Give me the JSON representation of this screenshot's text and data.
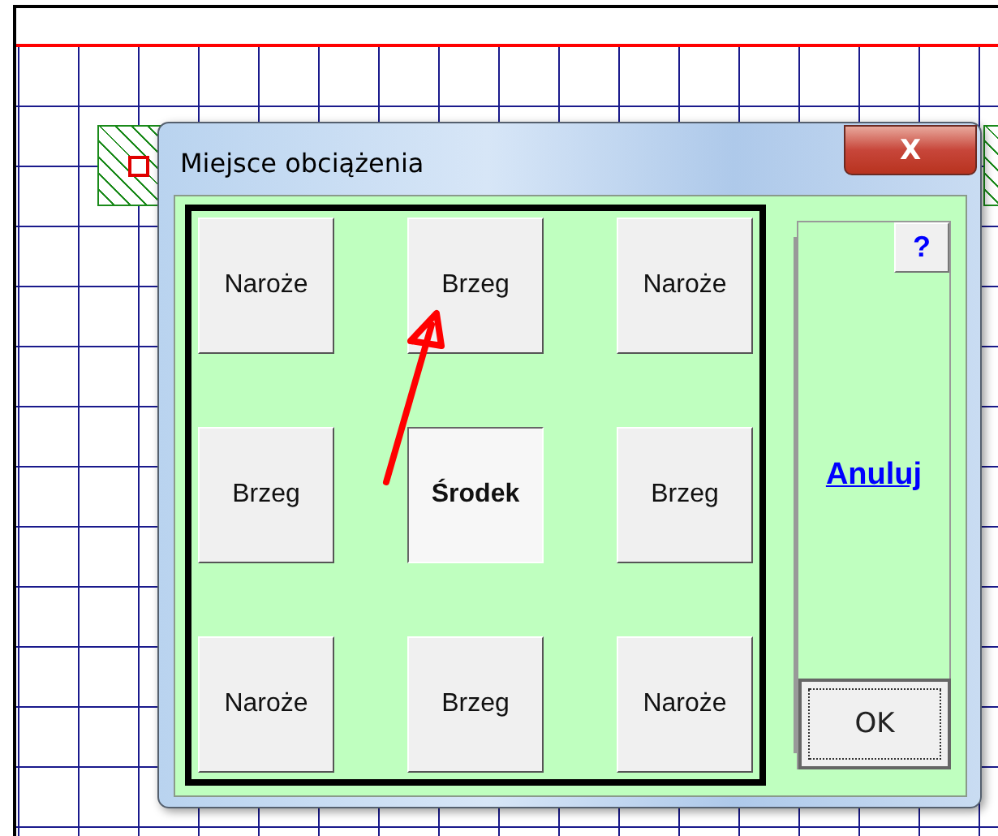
{
  "window": {
    "title": "Miejsce obciążenia",
    "close": "X"
  },
  "positions": [
    {
      "label": "Naroże",
      "selected": false
    },
    {
      "label": "Brzeg",
      "selected": false
    },
    {
      "label": "Naroże",
      "selected": false
    },
    {
      "label": "Brzeg",
      "selected": false
    },
    {
      "label": "Środek",
      "selected": true
    },
    {
      "label": "Brzeg",
      "selected": false
    },
    {
      "label": "Naroże",
      "selected": false
    },
    {
      "label": "Brzeg",
      "selected": false
    },
    {
      "label": "Naroże",
      "selected": false
    }
  ],
  "help": "?",
  "cancel": "Anuluj",
  "ok": {
    "label": "OK",
    "focused": true
  }
}
